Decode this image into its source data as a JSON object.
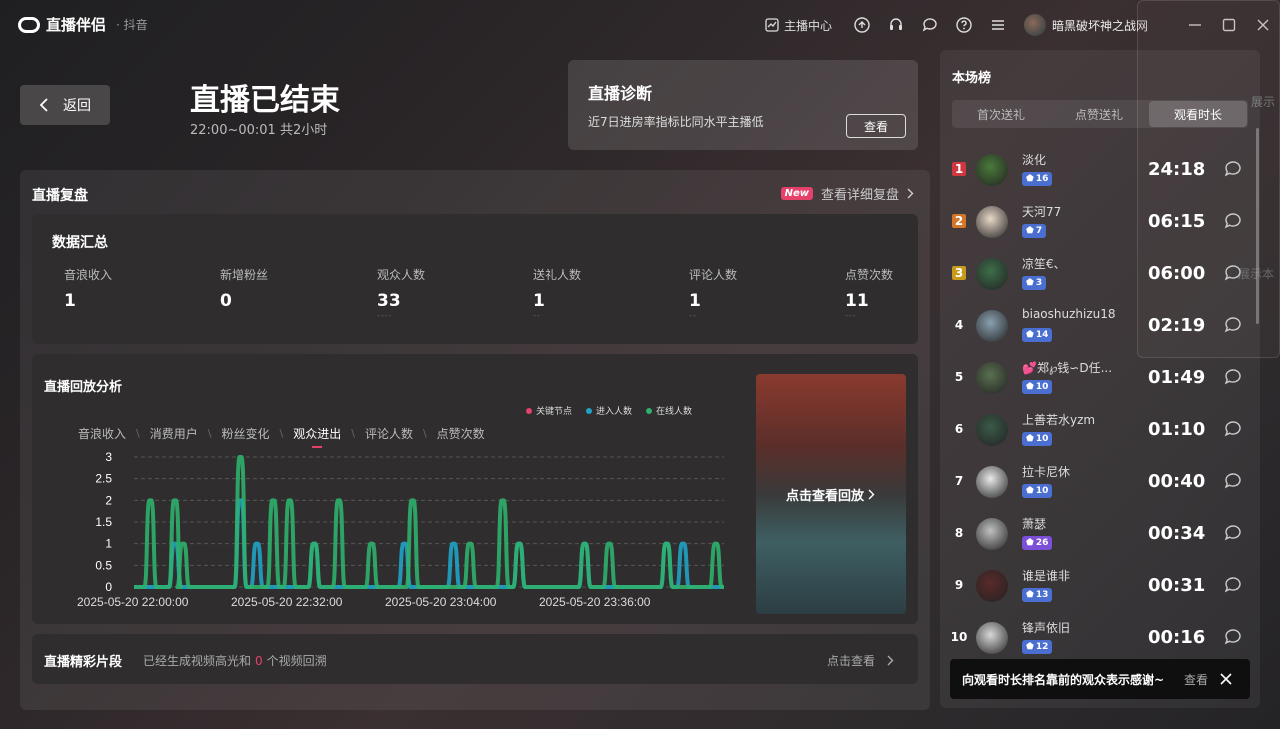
{
  "app": {
    "logo_text": "直播伴侣",
    "platform": "· 抖音"
  },
  "titlebar": {
    "anchor_center": "主播中心",
    "username": "暗黑破坏神之战网"
  },
  "header": {
    "back_label": "返回",
    "title": "直播已结束",
    "time_range": "22:00~00:01 共2小时"
  },
  "diagnosis": {
    "title": "直播诊断",
    "desc": "近7日进房率指标比同水平主播低",
    "button": "查看"
  },
  "review": {
    "title": "直播复盘",
    "new_badge": "New",
    "detail_link": "查看详细复盘"
  },
  "summary": {
    "title": "数据汇总",
    "stats": [
      {
        "label": "音浪收入",
        "value": "1",
        "dash": ""
      },
      {
        "label": "新增粉丝",
        "value": "0",
        "dash": ""
      },
      {
        "label": "观众人数",
        "value": "33",
        "dash": "----"
      },
      {
        "label": "送礼人数",
        "value": "1",
        "dash": "--"
      },
      {
        "label": "评论人数",
        "value": "1",
        "dash": "--"
      },
      {
        "label": "点赞次数",
        "value": "11",
        "dash": "---"
      }
    ]
  },
  "analysis": {
    "title": "直播回放分析",
    "metric_tabs": [
      "音浪收入",
      "消费用户",
      "粉丝变化",
      "观众进出",
      "评论人数",
      "点赞次数"
    ],
    "active_tab": 3,
    "legend": [
      {
        "label": "关键节点",
        "color": "#e5416a"
      },
      {
        "label": "进入人数",
        "color": "#1fa3c4"
      },
      {
        "label": "在线人数",
        "color": "#2fb06d"
      }
    ],
    "replay_label": "点击查看回放"
  },
  "chart_data": {
    "type": "line",
    "x": [
      "2025-05-20 22:00:00",
      "2025-05-20 22:32:00",
      "2025-05-20 23:04:00",
      "2025-05-20 23:36:00"
    ],
    "yticks": [
      "0",
      "0.5",
      "1",
      "1.5",
      "2",
      "2.5",
      "3"
    ],
    "ylim": [
      0,
      3
    ],
    "series": [
      {
        "name": "进入人数",
        "color": "#1fa3c4",
        "pulses": [
          [
            5,
            1
          ],
          [
            13,
            2
          ],
          [
            15,
            1
          ],
          [
            22,
            1
          ],
          [
            33,
            1
          ],
          [
            39,
            1
          ],
          [
            47,
            1
          ],
          [
            55,
            1
          ],
          [
            65,
            1
          ],
          [
            67,
            1
          ]
        ]
      },
      {
        "name": "在线人数",
        "color": "#2fb06d",
        "pulses": [
          [
            2,
            2
          ],
          [
            5,
            2
          ],
          [
            6,
            1
          ],
          [
            13,
            3
          ],
          [
            17,
            2
          ],
          [
            19,
            2
          ],
          [
            22,
            1
          ],
          [
            25,
            2
          ],
          [
            29,
            1
          ],
          [
            34,
            2
          ],
          [
            41,
            1
          ],
          [
            45,
            2
          ],
          [
            47,
            1
          ],
          [
            55,
            1
          ],
          [
            58,
            1
          ],
          [
            65,
            1
          ],
          [
            71,
            1
          ]
        ]
      }
    ]
  },
  "highlights": {
    "title": "直播精彩片段",
    "desc_before": "已经生成视频高光和",
    "count": "0",
    "desc_after": "个视频回溯",
    "link": "点击查看"
  },
  "ranking": {
    "title": "本场榜",
    "tabs": [
      "首次送礼",
      "点赞送礼",
      "观看时长"
    ],
    "active_tab": 2,
    "rows": [
      {
        "rank": "1",
        "name": "淡化",
        "level": "16",
        "time": "24:18",
        "rank_color": "#d0363f",
        "avatar": "#4a7a3a",
        "level_color": "blue"
      },
      {
        "rank": "2",
        "name": "天河77",
        "level": "7",
        "time": "06:15",
        "rank_color": "#d2762a",
        "avatar": "#e8d8c8",
        "level_color": "blue"
      },
      {
        "rank": "3",
        "name": "凉笙€、",
        "level": "3",
        "time": "06:00",
        "rank_color": "#c99a1a",
        "avatar": "#3d6e4a",
        "level_color": "blue"
      },
      {
        "rank": "4",
        "name": "biaoshuzhizu18",
        "level": "14",
        "time": "02:19",
        "rank_color": "",
        "avatar": "#8aa0b0",
        "level_color": "blue"
      },
      {
        "rank": "5",
        "name": "💕郑℘钱∽D任...",
        "level": "10",
        "time": "01:49",
        "rank_color": "",
        "avatar": "#5a7050",
        "level_color": "blue"
      },
      {
        "rank": "6",
        "name": "上善若水yzm",
        "level": "10",
        "time": "01:10",
        "rank_color": "",
        "avatar": "#3a5a48",
        "level_color": "blue"
      },
      {
        "rank": "7",
        "name": "拉卡尼休",
        "level": "10",
        "time": "00:40",
        "rank_color": "",
        "avatar": "#e9e9e9",
        "level_color": "blue"
      },
      {
        "rank": "8",
        "name": "萧瑟",
        "level": "26",
        "time": "00:34",
        "rank_color": "",
        "avatar": "#c0c0c0",
        "level_color": "purple"
      },
      {
        "rank": "9",
        "name": "谁是谁非",
        "level": "13",
        "time": "00:31",
        "rank_color": "",
        "avatar": "#5a2a2a",
        "level_color": "blue"
      },
      {
        "rank": "10",
        "name": "锋声依旧",
        "level": "12",
        "time": "00:16",
        "rank_color": "",
        "avatar": "#d8d8d8",
        "level_color": "blue"
      }
    ]
  },
  "toast": {
    "text": "向观看时长排名靠前的观众表示感谢~",
    "view": "查看"
  },
  "ghost_panel": {
    "label1": "展示",
    "label2": "展示本"
  }
}
